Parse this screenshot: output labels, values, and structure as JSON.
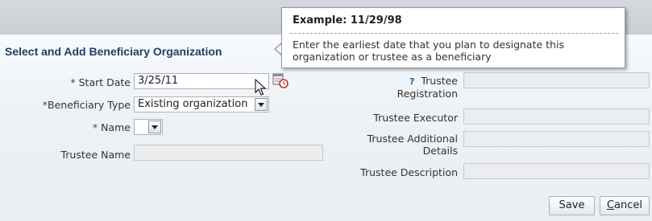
{
  "panel": {
    "title": "Select and Add Beneficiary Organization"
  },
  "tooltip": {
    "title": "Example: 11/29/98",
    "body": "Enter the earliest date that you plan to designate this organization or trustee as a beneficiary"
  },
  "form": {
    "required_marker": "*",
    "start_date_label": "Start Date",
    "start_date_value": "3/25/11",
    "beneficiary_type_label": "Beneficiary Type",
    "beneficiary_type_value": "Existing organization",
    "name_label": "Name",
    "name_value": "",
    "trustee_name_label": "Trustee Name",
    "trustee_registration_help": "?",
    "trustee_registration_label_1": "Trustee",
    "trustee_registration_label_2": "Registration",
    "trustee_executor_label": "Trustee Executor",
    "trustee_additional_label_1": "Trustee Additional",
    "trustee_additional_label_2": "Details",
    "trustee_description_label": "Trustee Description"
  },
  "buttons": {
    "save": "Save",
    "cancel": "Cancel",
    "cancel_access_key": "C",
    "cancel_rest": "ancel"
  },
  "icons": {
    "calendar": "calendar-icon",
    "cursor": "mouse-pointer-icon",
    "help": "help-icon",
    "dropdown": "chevron-down-icon"
  }
}
